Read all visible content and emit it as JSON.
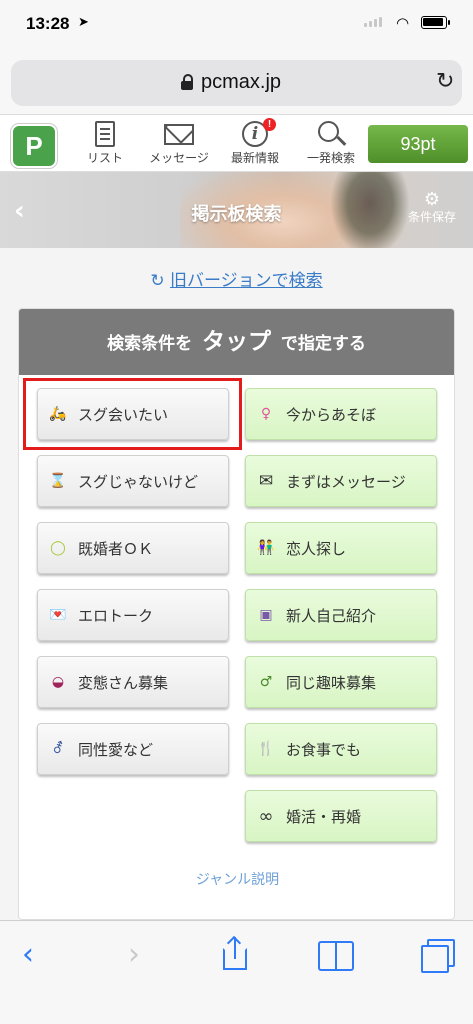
{
  "status_bar": {
    "time": "13:28",
    "location_icon": "location-arrow-icon"
  },
  "browser": {
    "url": "pcmax.jp"
  },
  "app_nav": {
    "logo": "P",
    "items": [
      {
        "label": "リスト",
        "icon": "list-icon"
      },
      {
        "label": "メッセージ",
        "icon": "mail-icon"
      },
      {
        "label": "最新情報",
        "icon": "info-icon",
        "badge": "!"
      },
      {
        "label": "一発検索",
        "icon": "search-icon"
      }
    ],
    "points": "93pt"
  },
  "banner": {
    "title": "掲示板検索",
    "save_label": "条件保存"
  },
  "old_version_link": "旧バージョンで検索",
  "panel": {
    "header_prefix": "検索条件を",
    "header_emphasis": "タップ",
    "header_suffix": "で指定する",
    "left_buttons": [
      {
        "label": "スグ会いたい",
        "icon": "scooter-icon",
        "glyph": "🛵"
      },
      {
        "label": "スグじゃないけど",
        "icon": "hourglass-icon",
        "glyph": "⌛"
      },
      {
        "label": "既婚者ＯＫ",
        "icon": "ring-icon",
        "glyph": "◯"
      },
      {
        "label": "エロトーク",
        "icon": "love-letter-icon",
        "glyph": "💌"
      },
      {
        "label": "変態さん募集",
        "icon": "mask-icon",
        "glyph": "◒"
      },
      {
        "label": "同性愛など",
        "icon": "gender-icon",
        "glyph": "⚦"
      }
    ],
    "right_buttons": [
      {
        "label": "今からあそぼ",
        "icon": "woman-icon",
        "glyph": "♀"
      },
      {
        "label": "まずはメッセージ",
        "icon": "envelope-icon",
        "glyph": "✉"
      },
      {
        "label": "恋人探し",
        "icon": "couple-icon",
        "glyph": "👫"
      },
      {
        "label": "新人自己紹介",
        "icon": "profile-card-icon",
        "glyph": "▣"
      },
      {
        "label": "同じ趣味募集",
        "icon": "hobby-person-icon",
        "glyph": "♂"
      },
      {
        "label": "お食事でも",
        "icon": "fork-knife-icon",
        "glyph": "🍴"
      },
      {
        "label": "婚活・再婚",
        "icon": "wedding-rings-icon",
        "glyph": "∞"
      }
    ],
    "genre_link": "ジャンル説明"
  },
  "colors": {
    "accent_green": "#5a9b34",
    "link_blue": "#3a7bc8",
    "highlight_red": "#e41b1b",
    "ios_blue": "#2f7af6"
  }
}
